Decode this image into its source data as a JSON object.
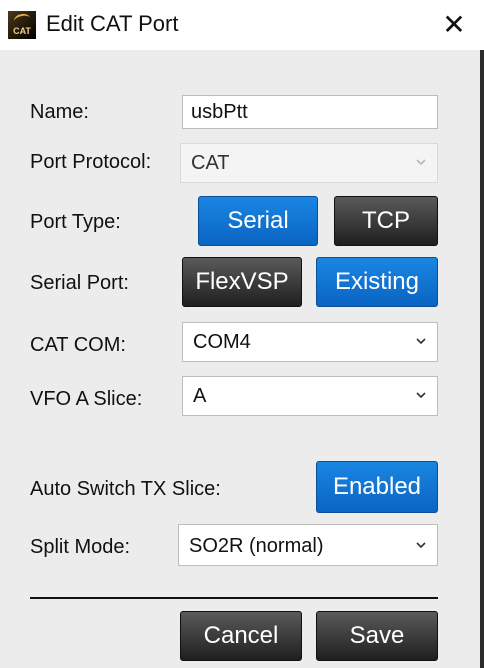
{
  "window": {
    "title": "Edit CAT Port",
    "icon_text": "CAT",
    "close_glyph": "✕"
  },
  "form": {
    "name": {
      "label": "Name:",
      "value": "usbPtt"
    },
    "port_protocol": {
      "label": "Port Protocol:",
      "value": "CAT"
    },
    "port_type": {
      "label": "Port Type:",
      "options": [
        "Serial",
        "TCP"
      ],
      "selected": "Serial"
    },
    "serial_port": {
      "label": "Serial Port:",
      "options": [
        "FlexVSP",
        "Existing"
      ],
      "selected": "Existing"
    },
    "cat_com": {
      "label": "CAT COM:",
      "value": "COM4"
    },
    "vfo_a_slice": {
      "label": "VFO A Slice:",
      "value": "A"
    },
    "auto_switch": {
      "label": "Auto Switch TX Slice:",
      "value": "Enabled"
    },
    "split_mode": {
      "label": "Split Mode:",
      "value": "SO2R (normal)"
    }
  },
  "actions": {
    "cancel": "Cancel",
    "save": "Save"
  },
  "colors": {
    "accent_blue": "#0a64c2",
    "dark_button": "#1f1f1f",
    "background": "#ececec"
  },
  "icons": {
    "dropdown": "chevron-down-icon",
    "close": "close-icon",
    "app": "cat-app-icon"
  }
}
